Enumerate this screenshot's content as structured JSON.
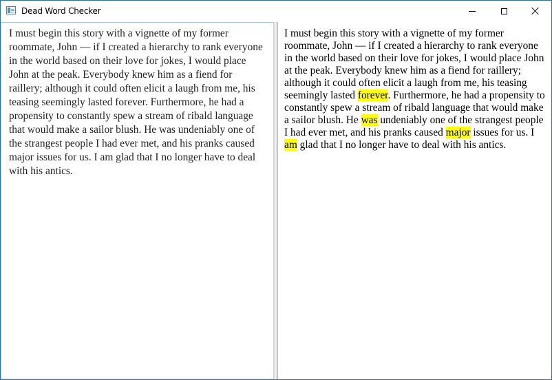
{
  "window": {
    "title": "Dead Word Checker"
  },
  "editor": {
    "text": "I must begin this story with a vignette of my former roommate, John — if I created a hierarchy to rank everyone in the world based on their love for jokes, I would place John at the peak. Everybody knew him as a fiend for raillery; although it could often elicit a laugh from me, his teasing seemingly lasted forever. Furthermore, he had a propensity to constantly spew a stream of ribald language that would make a sailor blush. He was undeniably one of the strangest people I had ever met, and his pranks caused major issues for us. I am glad that I no longer have to deal with his antics."
  },
  "preview": {
    "segments": [
      {
        "text": "I must begin this story with a vignette of my former roommate, John — if I created a hierarchy to rank everyone in the world based on their love for jokes, I would place John at the peak. Everybody knew him as a fiend for raillery; although it could often elicit a laugh from me, his teasing seemingly lasted ",
        "highlight": false
      },
      {
        "text": "forever",
        "highlight": true
      },
      {
        "text": ". Furthermore, he had a propensity to constantly spew a stream of ribald language that would make a sailor blush. He ",
        "highlight": false
      },
      {
        "text": "was",
        "highlight": true
      },
      {
        "text": " undeniably one of the strangest people I had ever met, and his pranks caused ",
        "highlight": false
      },
      {
        "text": "major",
        "highlight": true
      },
      {
        "text": " issues for us. I ",
        "highlight": false
      },
      {
        "text": "am",
        "highlight": true
      },
      {
        "text": " glad that I no longer have to deal with his antics.",
        "highlight": false
      }
    ],
    "highlight_color": "#ffff00"
  }
}
